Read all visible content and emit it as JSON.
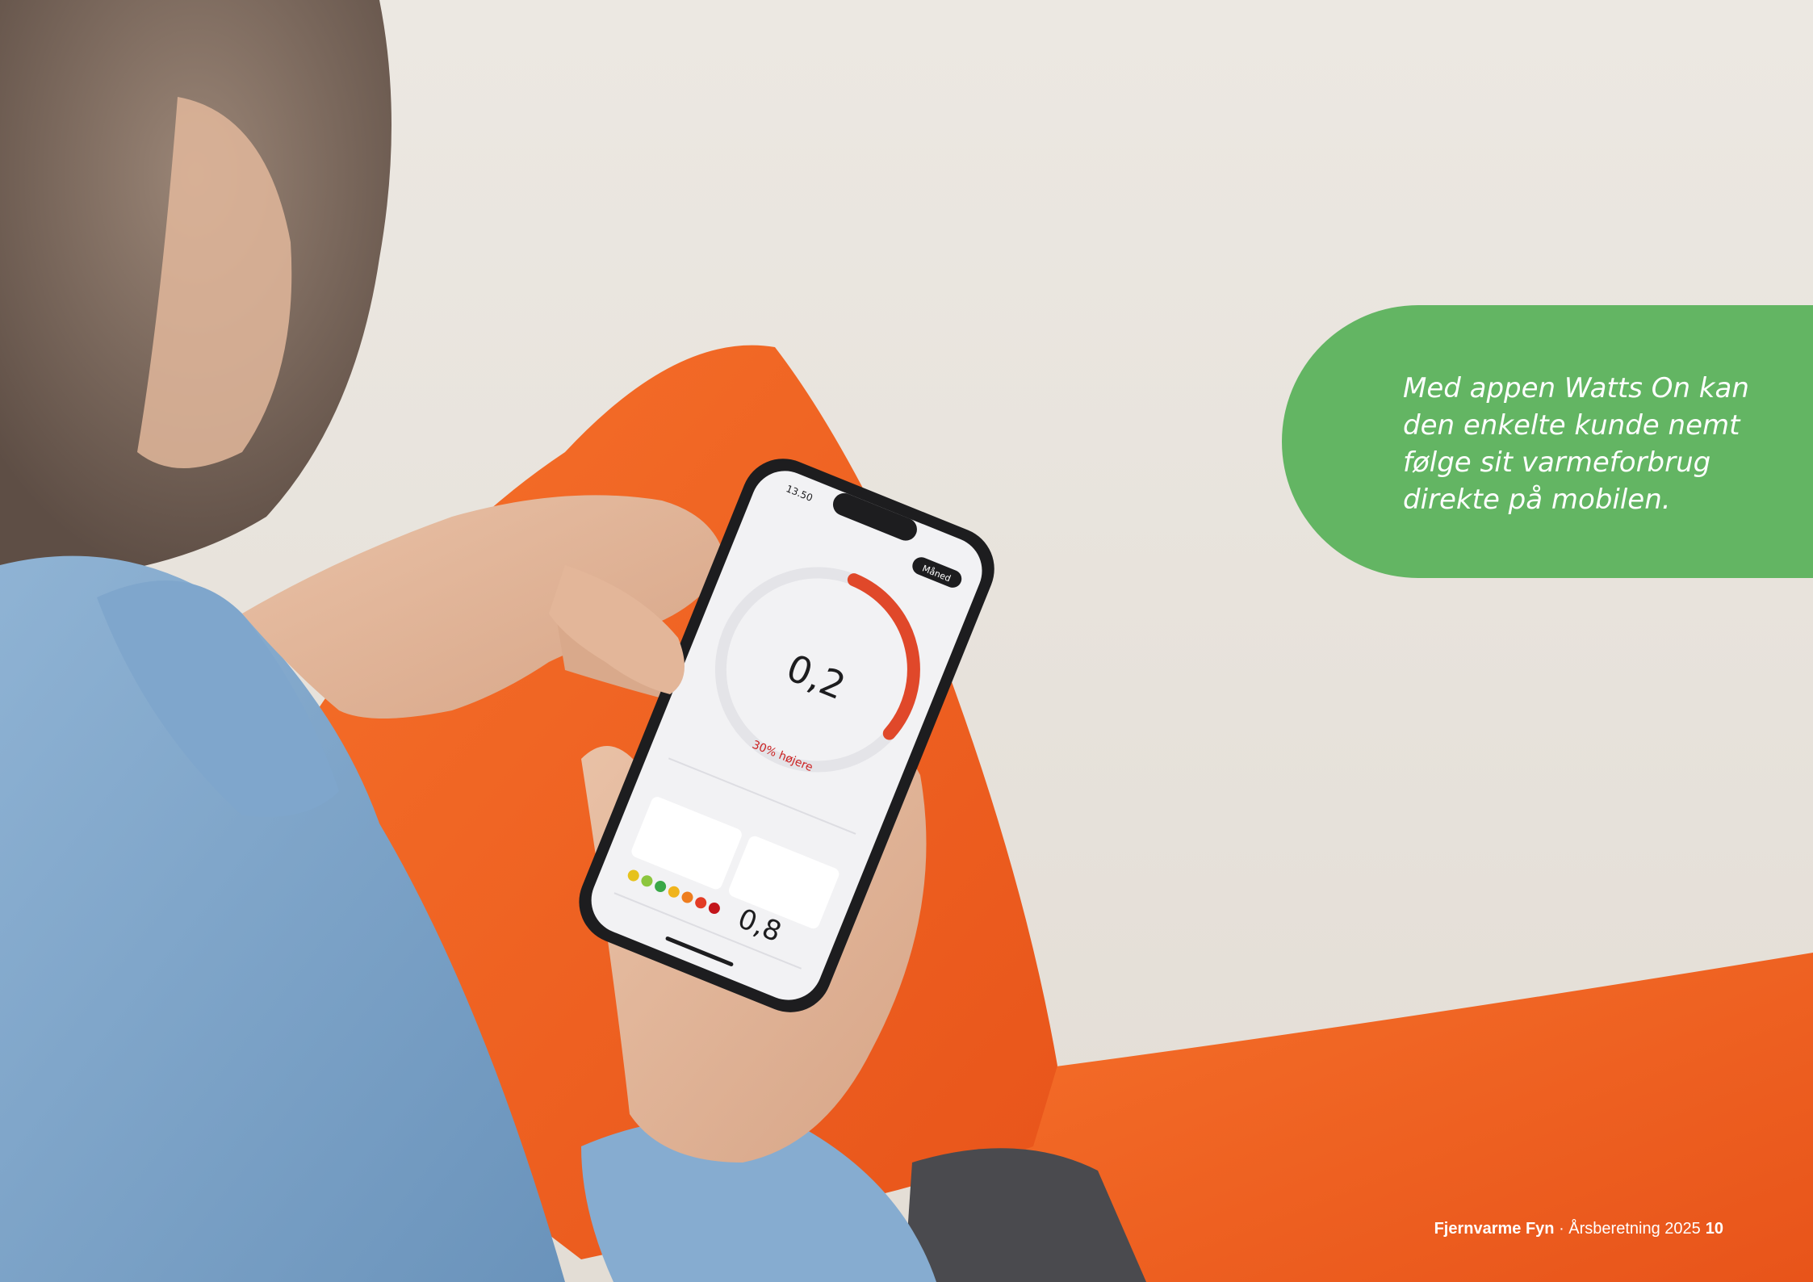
{
  "callout": {
    "text": "Med appen Watts On kan den enkelte kunde nemt følge sit varmeforbrug direkte på mobilen."
  },
  "footer": {
    "brand": "Fjernvarme Fyn",
    "separator": " · ",
    "report": "Årsberetning 2025",
    "page_number": "10"
  },
  "phone_screen": {
    "time": "13.50",
    "button_label": "Måned",
    "main_value": "0,2",
    "secondary_value": "0,8",
    "change_text": "30% højere"
  },
  "colors": {
    "callout_green": "#63b563",
    "cushion_orange": "#f0621f",
    "background": "#e7e2db"
  }
}
